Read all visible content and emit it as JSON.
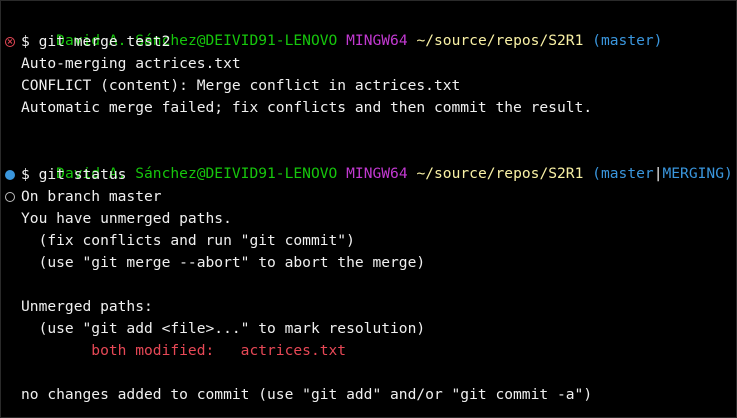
{
  "block1": {
    "prompt": {
      "user_host": "David A. Sánchez@DEIVID91-LENOVO",
      "shell": "MINGW64",
      "path": "~/source/repos/S2R1",
      "branch": "(master)"
    },
    "command": "$ git merge test2",
    "output": [
      "Auto-merging actrices.txt",
      "CONFLICT (content): Merge conflict in actrices.txt",
      "Automatic merge failed; fix conflicts and then commit the result."
    ]
  },
  "block2": {
    "prompt": {
      "user_host": "David A. Sánchez@DEIVID91-LENOVO",
      "shell": "MINGW64",
      "path": "~/source/repos/S2R1",
      "branch_open": "(master",
      "branch_sep": "|",
      "branch_state": "MERGING)"
    },
    "command": "$ git status",
    "output": [
      "On branch master",
      "You have unmerged paths.",
      "  (fix conflicts and run \"git commit\")",
      "  (use \"git merge --abort\" to abort the merge)",
      "Unmerged paths:",
      "  (use \"git add <file>...\" to mark resolution)"
    ],
    "modified_label": "        both modified:   ",
    "modified_file": "actrices.txt",
    "footer": "no changes added to commit (use \"git add\" and/or \"git commit -a\")"
  },
  "decorations": {
    "error_icon": "x-circle-icon",
    "success_icon": "filled-circle-icon",
    "neutral_icon": "hollow-circle-icon"
  },
  "colors": {
    "background": "#000000",
    "text": "#f0f0f0",
    "user_host": "#16c60c",
    "shell": "#c239d1",
    "path": "#f9f1a5",
    "branch": "#3a96dd",
    "conflict": "#e74856"
  }
}
